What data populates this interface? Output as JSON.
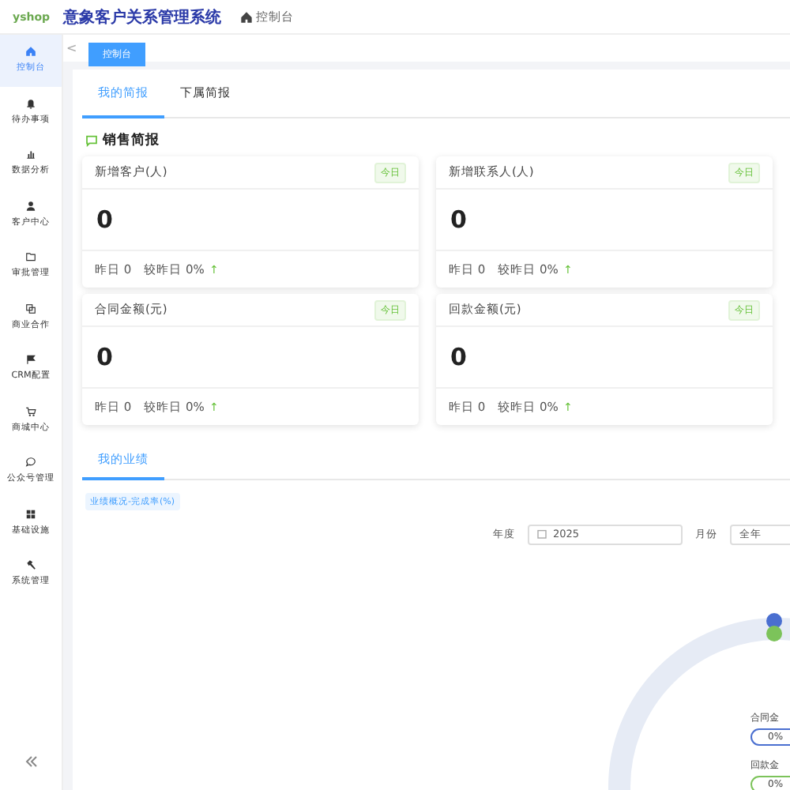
{
  "header": {
    "logo": "yshop",
    "title": "意象客户关系管理系统",
    "breadcrumb": "控制台"
  },
  "sidebar": {
    "items": [
      {
        "label": "控制台",
        "selected": true
      },
      {
        "label": "待办事项",
        "selected": false
      },
      {
        "label": "数据分析",
        "selected": false
      },
      {
        "label": "客户中心",
        "selected": false
      },
      {
        "label": "审批管理",
        "selected": false
      },
      {
        "label": "商业合作",
        "selected": false
      },
      {
        "label": "CRM配置",
        "selected": false
      },
      {
        "label": "商城中心",
        "selected": false
      },
      {
        "label": "公众号管理",
        "selected": false
      },
      {
        "label": "基础设施",
        "selected": false
      },
      {
        "label": "系统管理",
        "selected": false
      }
    ]
  },
  "tag_bar": {
    "back": "<",
    "tabs": [
      {
        "label": "控制台",
        "selected": true
      }
    ]
  },
  "report_tabs": [
    {
      "label": "我的简报",
      "selected": true
    },
    {
      "label": "下属简报",
      "selected": false
    }
  ],
  "section_title": "销售简报",
  "cards": [
    {
      "title": "新增客户(人)",
      "tag": "今日",
      "value": "0",
      "yesterday": "昨日 0",
      "compare": "较昨日 0%",
      "trend": "↑"
    },
    {
      "title": "新增联系人(人)",
      "tag": "今日",
      "value": "0",
      "yesterday": "昨日 0",
      "compare": "较昨日 0%",
      "trend": "↑"
    },
    {
      "title": "合同金额(元)",
      "tag": "今日",
      "value": "0",
      "yesterday": "昨日 0",
      "compare": "较昨日 0%",
      "trend": "↑"
    },
    {
      "title": "回款金额(元)",
      "tag": "今日",
      "value": "0",
      "yesterday": "昨日 0",
      "compare": "较昨日 0%",
      "trend": "↑"
    }
  ],
  "performance": {
    "tabs": [
      {
        "label": "我的业绩",
        "selected": true
      }
    ],
    "tag": "业绩概况-完成率(%)",
    "filters": [
      {
        "label": "年度",
        "value": "2025",
        "kind": "date"
      },
      {
        "label": "月份",
        "value": "全年",
        "kind": "select"
      }
    ],
    "legend": [
      {
        "label": "合同金",
        "value": "0%",
        "color": "#4a6fd0"
      },
      {
        "label": "回款金",
        "value": "0%",
        "color": "#7cc35a"
      }
    ]
  }
}
